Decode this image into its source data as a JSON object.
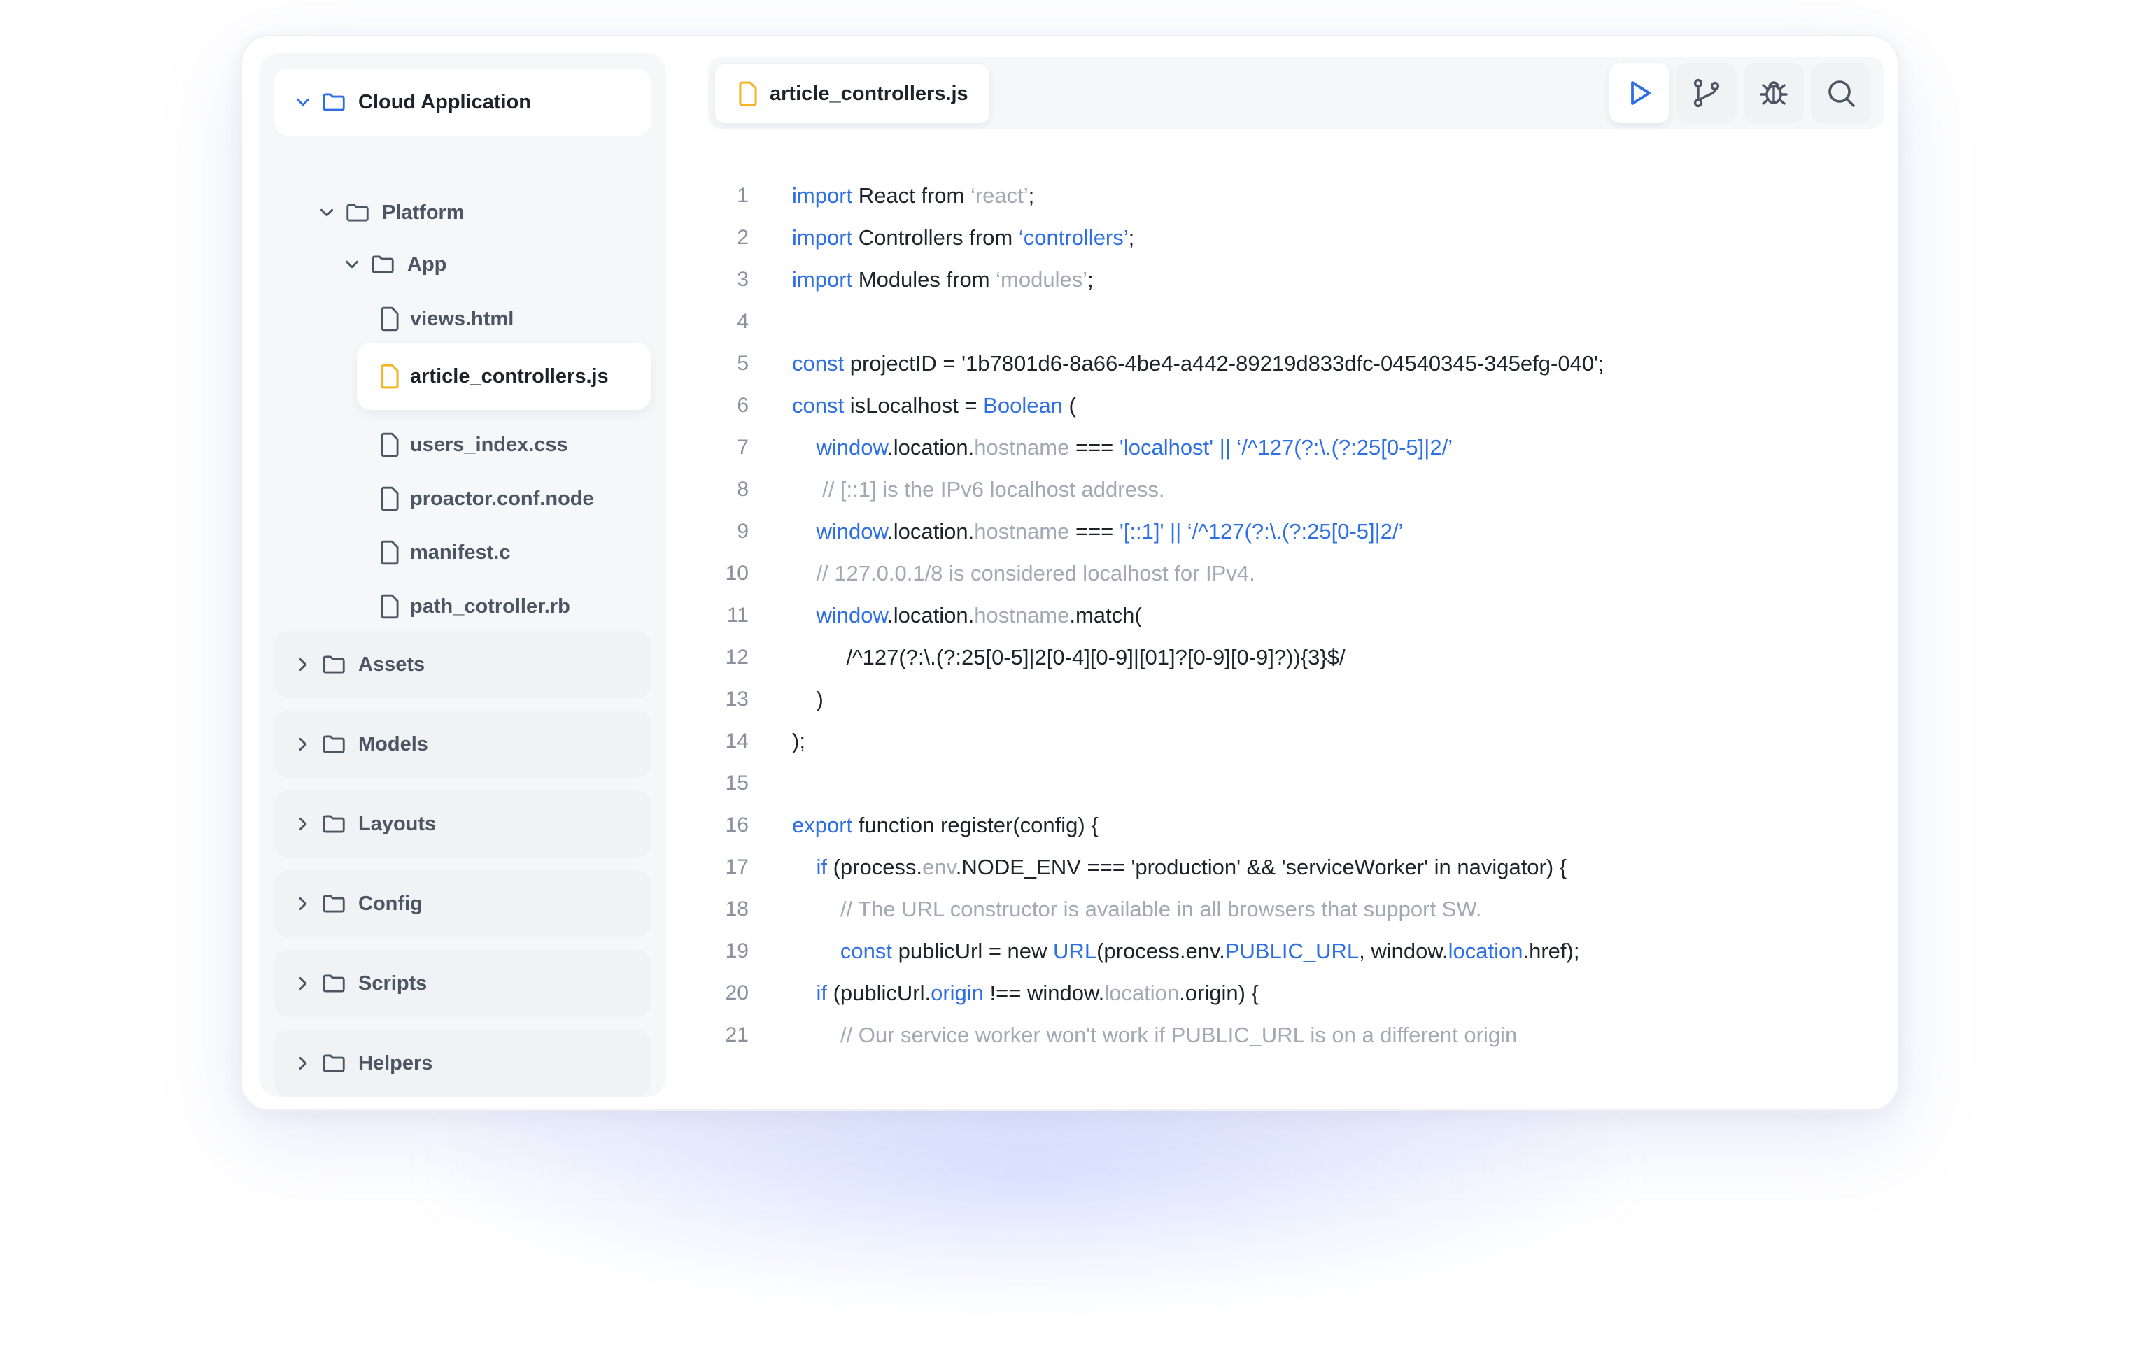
{
  "sidebar": {
    "root": {
      "label": "Cloud Application",
      "icon": "folder-icon",
      "expanded": true
    },
    "tree": [
      {
        "label": "Platform",
        "type": "folder",
        "expanded": true
      },
      {
        "label": "App",
        "type": "folder",
        "expanded": true
      },
      {
        "label": "views.html",
        "type": "file"
      },
      {
        "label": "article_controllers.js",
        "type": "file",
        "active": true
      },
      {
        "label": "users_index.css",
        "type": "file"
      },
      {
        "label": "proactor.conf.node",
        "type": "file"
      },
      {
        "label": "manifest.c",
        "type": "file"
      },
      {
        "label": "path_cotroller.rb",
        "type": "file"
      }
    ],
    "groups": [
      {
        "label": "Assets"
      },
      {
        "label": "Models"
      },
      {
        "label": "Layouts"
      },
      {
        "label": "Config"
      },
      {
        "label": "Scripts"
      },
      {
        "label": "Helpers"
      }
    ]
  },
  "editor": {
    "tab": {
      "label": "article_controllers.js",
      "icon": "file-icon"
    },
    "toolbar": [
      {
        "name": "run-button",
        "icon": "play-icon",
        "active": true
      },
      {
        "name": "git-branch-button",
        "icon": "git-branch-icon"
      },
      {
        "name": "debug-button",
        "icon": "bug-icon"
      },
      {
        "name": "search-button",
        "icon": "search-icon"
      }
    ],
    "lines": [
      {
        "n": "1",
        "t": [
          [
            "kw",
            "import"
          ],
          [
            "p",
            " React from "
          ],
          [
            "str",
            "‘react’"
          ],
          [
            "p",
            ";"
          ]
        ]
      },
      {
        "n": "2",
        "t": [
          [
            "kw",
            "import"
          ],
          [
            "p",
            " Controllers from "
          ],
          [
            "blue",
            "‘controllers’"
          ],
          [
            "p",
            ";"
          ]
        ]
      },
      {
        "n": "3",
        "t": [
          [
            "kw",
            "import"
          ],
          [
            "p",
            " Modules from "
          ],
          [
            "str",
            "‘modules’"
          ],
          [
            "p",
            ";"
          ]
        ]
      },
      {
        "n": "4",
        "t": []
      },
      {
        "n": "5",
        "t": [
          [
            "kw",
            "const"
          ],
          [
            "p",
            " projectID = '1b7801d6-8a66-4be4-a442-89219d833dfc-04540345-345efg-040';"
          ]
        ]
      },
      {
        "n": "6",
        "t": [
          [
            "kw",
            "const"
          ],
          [
            "p",
            " isLocalhost = "
          ],
          [
            "blue",
            "Boolean"
          ],
          [
            "p",
            " ("
          ]
        ]
      },
      {
        "n": "7",
        "t": [
          [
            "p",
            "    "
          ],
          [
            "blue",
            "window"
          ],
          [
            "p",
            ".location."
          ],
          [
            "str",
            "hostname"
          ],
          [
            "p",
            " === "
          ],
          [
            "blue",
            "'localhost' || ‘/^127(?:\\.(?:25[0-5]|2/’"
          ]
        ]
      },
      {
        "n": "8",
        "t": [
          [
            "p",
            "     "
          ],
          [
            "cm",
            "// [::1] is the IPv6 localhost address."
          ]
        ]
      },
      {
        "n": "9",
        "t": [
          [
            "p",
            "    "
          ],
          [
            "blue",
            "window"
          ],
          [
            "p",
            ".location."
          ],
          [
            "str",
            "hostname"
          ],
          [
            "p",
            " === "
          ],
          [
            "blue",
            "'[::1]' || ‘/^127(?:\\.(?:25[0-5]|2/’"
          ]
        ]
      },
      {
        "n": "10",
        "t": [
          [
            "p",
            "    "
          ],
          [
            "cm",
            "// 127.0.0.1/8 is considered localhost for IPv4."
          ]
        ]
      },
      {
        "n": "11",
        "t": [
          [
            "p",
            "    "
          ],
          [
            "blue",
            "window"
          ],
          [
            "p",
            ".location."
          ],
          [
            "str",
            "hostname"
          ],
          [
            "p",
            ".match("
          ]
        ]
      },
      {
        "n": "12",
        "t": [
          [
            "p",
            "         /^127(?:\\.(?:25[0-5]|2[0-4][0-9]|[01]?[0-9][0-9]?)){3}$/"
          ]
        ]
      },
      {
        "n": "13",
        "t": [
          [
            "p",
            "    )"
          ]
        ]
      },
      {
        "n": "14",
        "t": [
          [
            "p",
            ");"
          ]
        ]
      },
      {
        "n": "15",
        "t": []
      },
      {
        "n": "16",
        "t": [
          [
            "kw",
            "export"
          ],
          [
            "p",
            " function register(config) {"
          ]
        ]
      },
      {
        "n": "17",
        "t": [
          [
            "p",
            "    "
          ],
          [
            "kw",
            "if"
          ],
          [
            "p",
            " (process."
          ],
          [
            "str",
            "env"
          ],
          [
            "p",
            ".NODE_ENV === 'production' && 'serviceWorker' in navigator) {"
          ]
        ]
      },
      {
        "n": "18",
        "t": [
          [
            "p",
            "        "
          ],
          [
            "cm",
            "// The URL constructor is available in all browsers that support SW."
          ]
        ]
      },
      {
        "n": "19",
        "t": [
          [
            "p",
            "        "
          ],
          [
            "kw",
            "const"
          ],
          [
            "p",
            " publicUrl = new "
          ],
          [
            "blue",
            "URL"
          ],
          [
            "p",
            "(process.env."
          ],
          [
            "blue",
            "PUBLIC_URL"
          ],
          [
            "p",
            ", window."
          ],
          [
            "blue",
            "location"
          ],
          [
            "p",
            ".href);"
          ]
        ]
      },
      {
        "n": "20",
        "t": [
          [
            "p",
            "    "
          ],
          [
            "kw",
            "if"
          ],
          [
            "p",
            " (publicUrl."
          ],
          [
            "blue",
            "origin"
          ],
          [
            "p",
            " !== window."
          ],
          [
            "str",
            "location"
          ],
          [
            "p",
            ".origin) {"
          ]
        ]
      },
      {
        "n": "21",
        "t": [
          [
            "p",
            "        "
          ],
          [
            "cm",
            "// Our service worker won't work if PUBLIC_URL is on a different origin"
          ]
        ]
      }
    ]
  },
  "colors": {
    "accent": "#2f6fe4",
    "file_active": "#f5b324",
    "muted_code": "#a3a9b3"
  }
}
